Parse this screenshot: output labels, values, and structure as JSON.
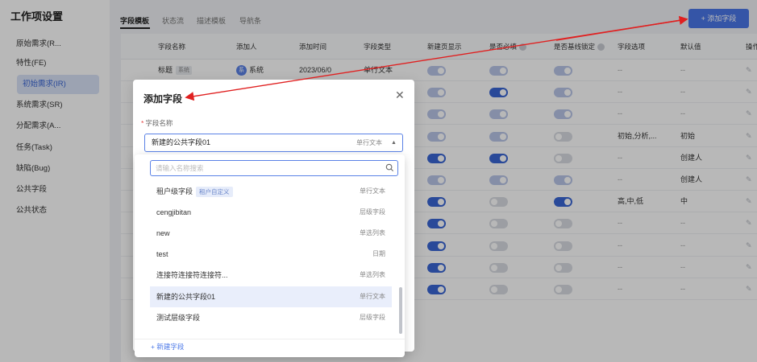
{
  "sidebar": {
    "title": "工作项设置",
    "items": [
      {
        "label": "原始需求(R..."
      },
      {
        "label": "特性(FE)"
      },
      {
        "label": "初始需求(IR)"
      },
      {
        "label": "系统需求(SR)"
      },
      {
        "label": "分配需求(A..."
      },
      {
        "label": "任务(Task)"
      },
      {
        "label": "缺陷(Bug)"
      },
      {
        "label": "公共字段"
      },
      {
        "label": "公共状态"
      }
    ]
  },
  "tabs": [
    "字段模板",
    "状态流",
    "描述模板",
    "导航条"
  ],
  "add_field_button": "+ 添加字段",
  "table": {
    "headers": [
      "字段名称",
      "添加人",
      "添加时间",
      "字段类型",
      "新建页显示",
      "是否必填",
      "是否基线锁定",
      "字段选项",
      "默认值",
      "操作"
    ],
    "first_row": {
      "name": "标题",
      "tag": "系统",
      "avatar": "系",
      "adder": "系统",
      "time": "2023/06/0",
      "type": "单行文本"
    },
    "rows": [
      {
        "options": "--",
        "default": "--",
        "t1": "half",
        "t2": "half",
        "t3": "half"
      },
      {
        "options": "--",
        "default": "--",
        "t1": "half",
        "t2": "on",
        "t3": "half"
      },
      {
        "options": "--",
        "default": "--",
        "t1": "half",
        "t2": "half",
        "t3": "half"
      },
      {
        "options": "初始,分析,...",
        "default": "初始",
        "t1": "half",
        "t2": "half",
        "t3": "off"
      },
      {
        "options": "--",
        "default": "创建人",
        "t1": "on",
        "t2": "on",
        "t3": "off"
      },
      {
        "options": "--",
        "default": "创建人",
        "t1": "half",
        "t2": "half",
        "t3": "half"
      },
      {
        "options": "高,中,低",
        "default": "中",
        "t1": "on",
        "t2": "off",
        "t3": "on"
      },
      {
        "options": "--",
        "default": "--",
        "t1": "on",
        "t2": "off",
        "t3": "off"
      },
      {
        "options": "--",
        "default": "--",
        "t1": "on",
        "t2": "off",
        "t3": "off"
      },
      {
        "options": "--",
        "default": "--",
        "t1": "on",
        "t2": "off",
        "t3": "off"
      },
      {
        "options": "--",
        "default": "--",
        "t1": "on",
        "t2": "off",
        "t3": "off"
      }
    ]
  },
  "modal": {
    "title": "添加字段",
    "field_label": "字段名称",
    "required_mark": "*",
    "select_value": "新建的公共字段01",
    "select_type": "单行文本",
    "search_placeholder": "请输入名称搜索",
    "options": [
      {
        "label": "租户级字段",
        "tag": "租户自定义",
        "type": "单行文本"
      },
      {
        "label": "cengjibitan",
        "tag": "",
        "type": "层级字段"
      },
      {
        "label": "new",
        "tag": "",
        "type": "单选列表"
      },
      {
        "label": "test",
        "tag": "",
        "type": "日期"
      },
      {
        "label": "连接符连接符连接符...",
        "tag": "",
        "type": "单选列表"
      },
      {
        "label": "新建的公共字段01",
        "tag": "",
        "type": "单行文本"
      },
      {
        "label": "测试层级字段",
        "tag": "",
        "type": "层级字段"
      }
    ],
    "new_field_link": "+ 新建字段"
  },
  "colors": {
    "accent": "#4a77e8",
    "annotation_arrow": "#e02020"
  }
}
